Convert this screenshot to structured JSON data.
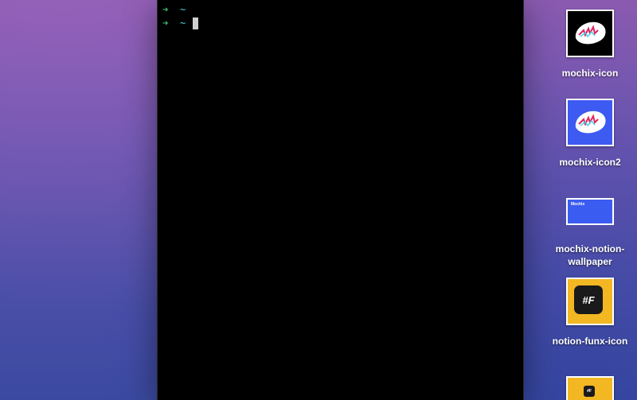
{
  "terminal": {
    "lines": [
      {
        "arrow": "➜",
        "dir": "~"
      },
      {
        "arrow": "➜",
        "dir": "~"
      }
    ]
  },
  "desktop": {
    "icons": [
      {
        "label": "mochix-icon",
        "icon": "mochix-hat-icon",
        "bg": "#000000"
      },
      {
        "label": "mochix-icon2",
        "icon": "mochix-hat-icon",
        "bg": "#3d5af1"
      },
      {
        "label": "mochix-notion-wallpaper",
        "icon": "wallpaper-thumbnail",
        "thumb_text": "Mochix",
        "bg": "#3b5cf0"
      },
      {
        "label": "notion-funx-icon",
        "icon": "funx-icon",
        "glyph": "#F",
        "bg": "#f2b722"
      },
      {
        "label": "",
        "icon": "funx-icon",
        "glyph": "#F",
        "bg": "#f2b722"
      }
    ]
  },
  "colors": {
    "prompt_arrow": "#38c172",
    "prompt_dir": "#4fd1e8",
    "terminal_bg": "#000000"
  }
}
